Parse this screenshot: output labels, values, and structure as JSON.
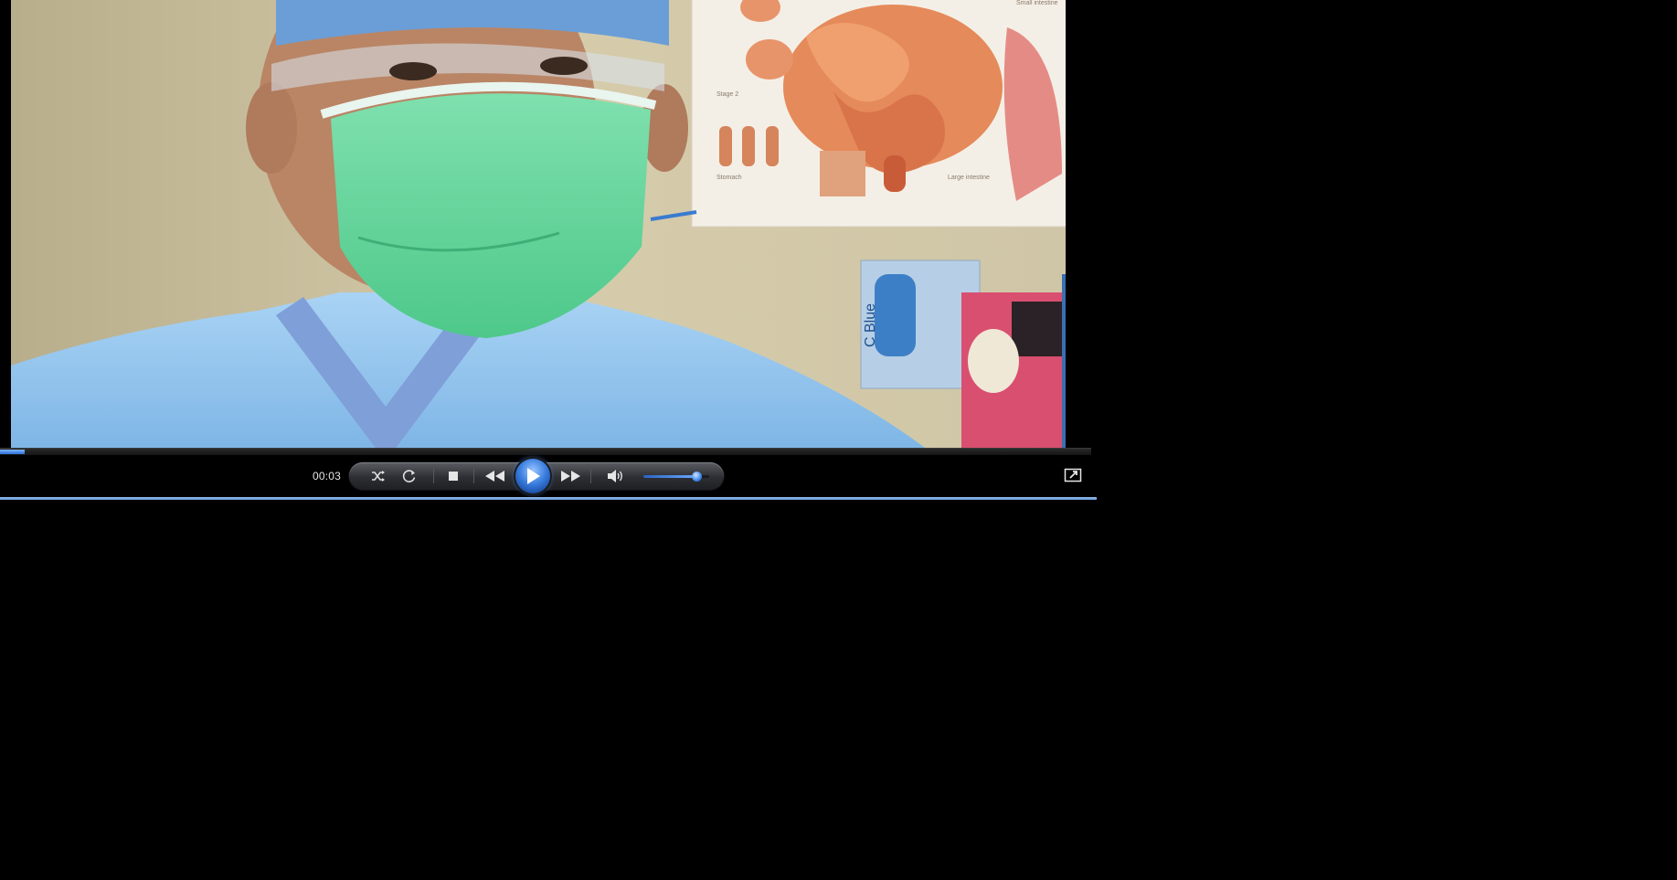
{
  "player": {
    "elapsed_time": "00:03",
    "seek_progress_percent": 2.3,
    "volume_percent": 80
  },
  "video": {
    "poster_texts": [
      "Small intestine",
      "Stage 2",
      "Stomach",
      "Large intestine"
    ],
    "glove_box_label": "C Blue"
  },
  "colors": {
    "accent": "#3c7fe0",
    "background": "#000000",
    "mask_green": "#5fcf95",
    "scrubs_blue": "#8ec0ea"
  },
  "icons": {
    "shuffle": "shuffle-icon",
    "repeat": "repeat-icon",
    "stop": "stop-icon",
    "previous": "rewind-icon",
    "play": "play-icon",
    "next": "fast-forward-icon",
    "mute": "speaker-icon",
    "fullscreen": "switch-to-library-icon"
  }
}
